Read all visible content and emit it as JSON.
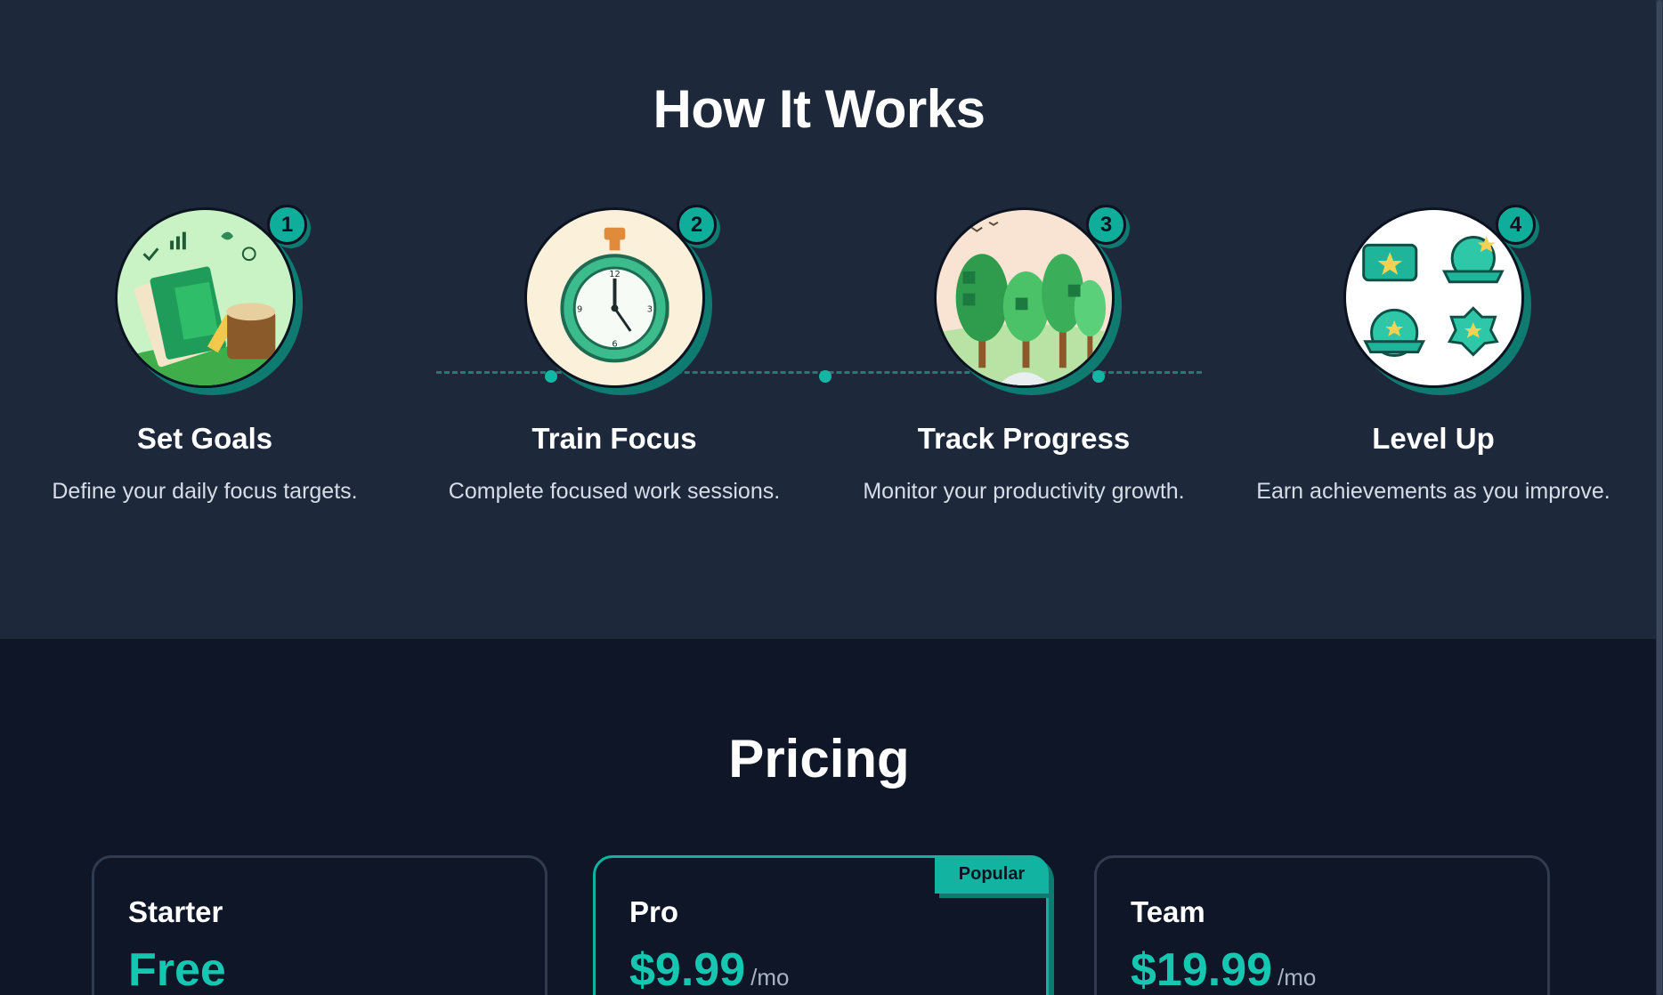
{
  "how_it_works": {
    "title": "How It Works",
    "steps": [
      {
        "number": "1",
        "title": "Set Goals",
        "description": "Define your daily focus targets.",
        "image": "goals-illustration"
      },
      {
        "number": "2",
        "title": "Train Focus",
        "description": "Complete focused work sessions.",
        "image": "stopwatch-illustration"
      },
      {
        "number": "3",
        "title": "Track Progress",
        "description": "Monitor your productivity growth.",
        "image": "forest-illustration"
      },
      {
        "number": "4",
        "title": "Level Up",
        "description": "Earn achievements as you improve.",
        "image": "badges-illustration"
      }
    ]
  },
  "pricing": {
    "title": "Pricing",
    "plans": [
      {
        "name": "Starter",
        "price": "Free",
        "period": ""
      },
      {
        "name": "Pro",
        "price": "$9.99",
        "period": "/mo",
        "tag": "Popular"
      },
      {
        "name": "Team",
        "price": "$19.99",
        "period": "/mo"
      }
    ]
  },
  "colors": {
    "background": "#1e283b",
    "pricing_background": "#0e1627",
    "accent": "#13b6a3",
    "accent_shadow": "#0e7a70"
  }
}
